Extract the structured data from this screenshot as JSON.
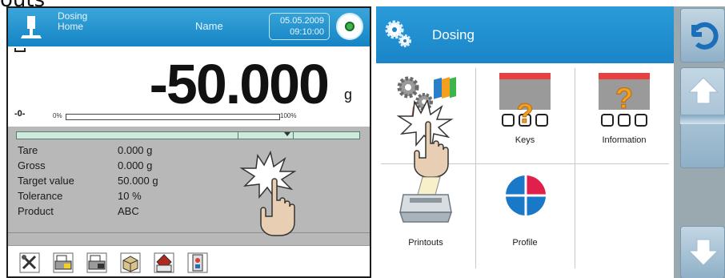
{
  "page": {
    "heading": "outs"
  },
  "left_screen": {
    "header": {
      "mode_line1": "Dosing",
      "mode_line2": "Home",
      "name": "Name",
      "date": "05.05.2009",
      "time": "09:10:00"
    },
    "reading": {
      "value": "-50.000",
      "unit": "g"
    },
    "zero_indicator": "-0-",
    "bargraph": {
      "min_label": "0%",
      "max_label": "100%",
      "level_percent": 0
    },
    "info_rows": [
      {
        "label": "Tare",
        "value": "0.000  g"
      },
      {
        "label": "Gross",
        "value": "0.000  g"
      },
      {
        "label": "Target value",
        "value": "50.000  g"
      },
      {
        "label": "Tolerance",
        "value": "10 %"
      },
      {
        "label": "Product",
        "value": "ABC"
      }
    ],
    "toolbar_icons": [
      "tools-icon",
      "printer-tare-icon",
      "printer-gross-icon",
      "package-icon",
      "database-icon",
      "report-icon"
    ]
  },
  "right_screen": {
    "header": {
      "title": "Dosing"
    },
    "tiles": [
      {
        "label": "",
        "icon": "settings-gears-icon"
      },
      {
        "label": "Keys",
        "icon": "keys-icon"
      },
      {
        "label": "Information",
        "icon": "information-icon"
      },
      {
        "label": "Printouts",
        "icon": "printer-icon"
      },
      {
        "label": "Profile",
        "icon": "profile-icon"
      },
      {
        "label": "",
        "icon": ""
      }
    ],
    "side_buttons": [
      "back-icon",
      "scroll-up-icon",
      "scroll-down-icon"
    ]
  },
  "colors": {
    "header_blue": "#1584c4",
    "info_panel_gray": "#b8b8b8",
    "status_green": "#3cb54a",
    "keys_red": "#e84040",
    "question_orange": "#f2a01e",
    "profile_red": "#e0204a",
    "profile_blue": "#1a78c8"
  }
}
